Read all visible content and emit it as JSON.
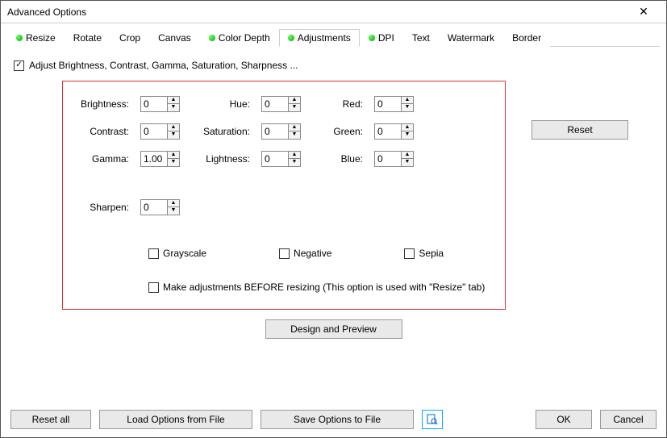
{
  "window": {
    "title": "Advanced Options"
  },
  "tabs": {
    "resize": "Resize",
    "rotate": "Rotate",
    "crop": "Crop",
    "canvas": "Canvas",
    "colordepth": "Color Depth",
    "adjustments": "Adjustments",
    "dpi": "DPI",
    "text": "Text",
    "watermark": "Watermark",
    "border": "Border"
  },
  "checkbox": {
    "main": "Adjust Brightness, Contrast, Gamma, Saturation, Sharpness ...",
    "main_checked": "✓"
  },
  "fields": {
    "brightness": {
      "label": "Brightness:",
      "value": "0"
    },
    "contrast": {
      "label": "Contrast:",
      "value": "0"
    },
    "gamma": {
      "label": "Gamma:",
      "value": "1.00"
    },
    "hue": {
      "label": "Hue:",
      "value": "0"
    },
    "saturation": {
      "label": "Saturation:",
      "value": "0"
    },
    "lightness": {
      "label": "Lightness:",
      "value": "0"
    },
    "red": {
      "label": "Red:",
      "value": "0"
    },
    "green": {
      "label": "Green:",
      "value": "0"
    },
    "blue": {
      "label": "Blue:",
      "value": "0"
    },
    "sharpen": {
      "label": "Sharpen:",
      "value": "0"
    }
  },
  "toggles": {
    "grayscale": "Grayscale",
    "negative": "Negative",
    "sepia": "Sepia",
    "before": "Make adjustments BEFORE resizing (This option is used with \"Resize\" tab)"
  },
  "buttons": {
    "reset": "Reset",
    "design": "Design and Preview",
    "resetall": "Reset all",
    "load": "Load Options from File",
    "save": "Save Options to File",
    "ok": "OK",
    "cancel": "Cancel"
  }
}
